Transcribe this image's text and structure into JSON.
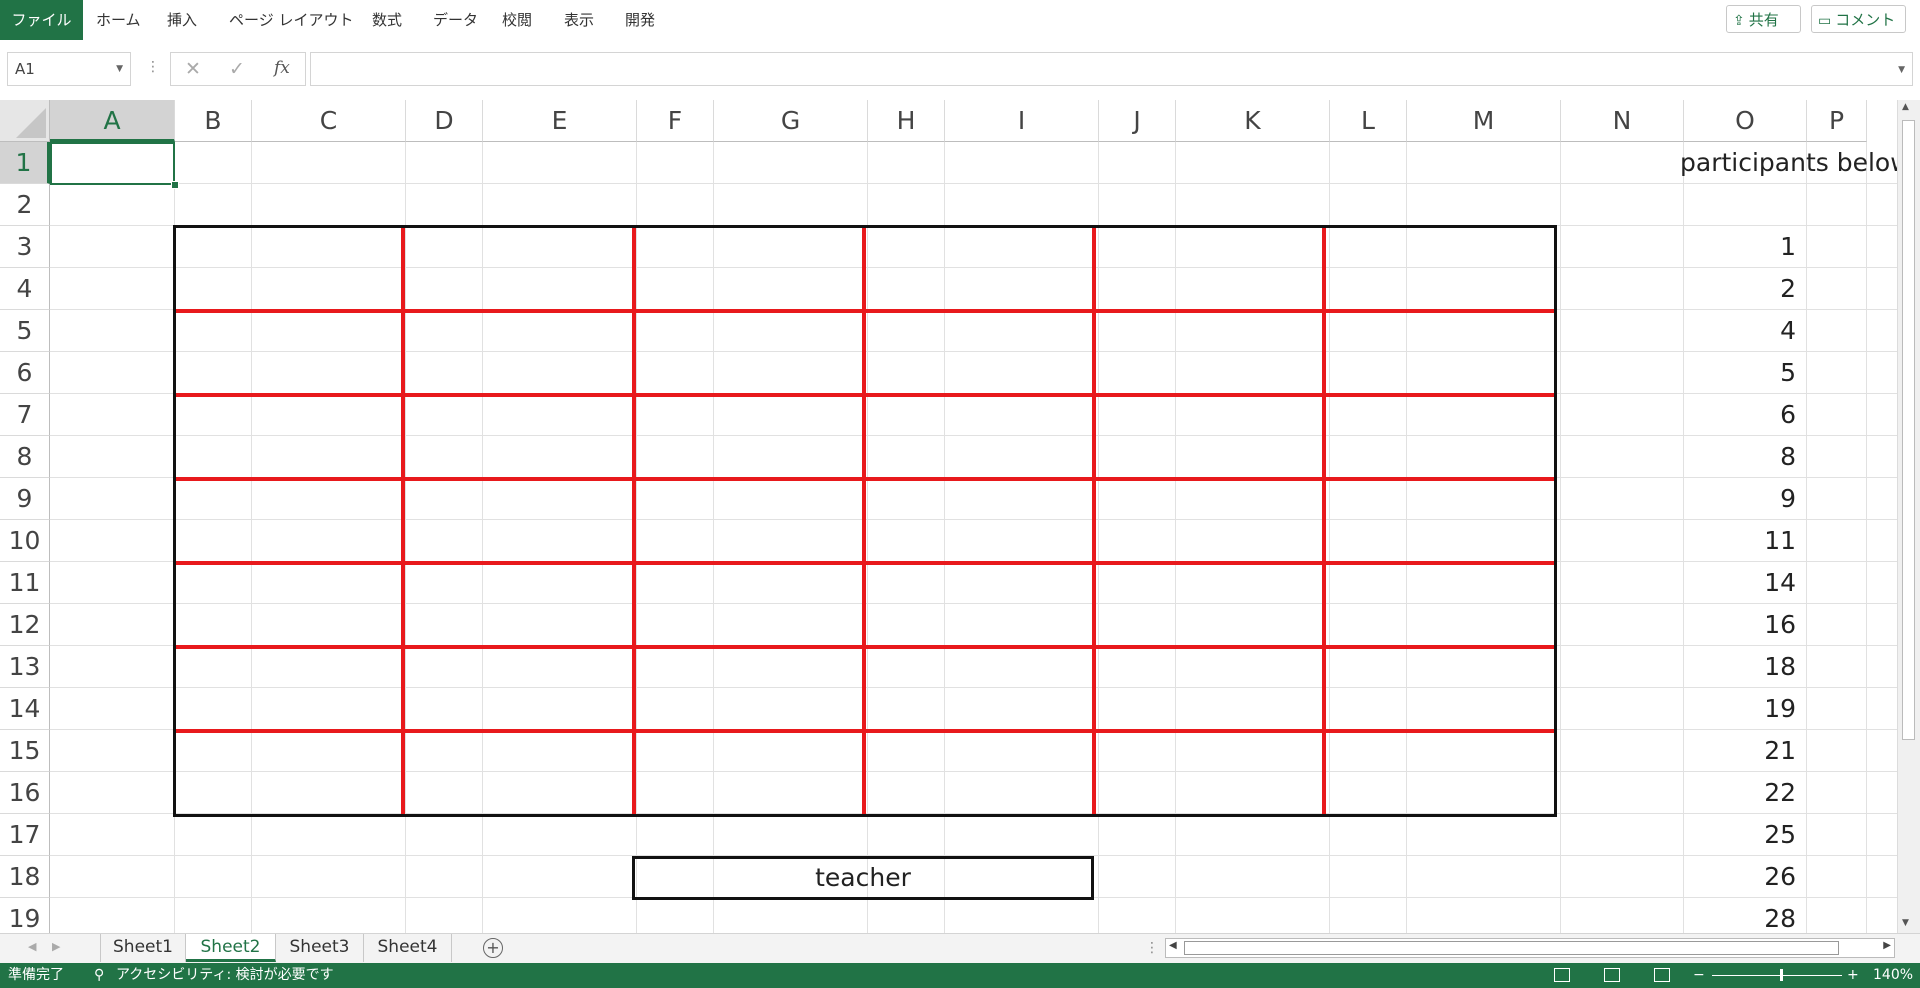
{
  "ribbon": {
    "file_tab": "ファイル",
    "tabs": [
      "ホーム",
      "挿入",
      "ページ レイアウト",
      "数式",
      "データ",
      "校閲",
      "表示",
      "開発"
    ],
    "share_label": "共有",
    "comment_label": "コメント"
  },
  "formula_bar": {
    "name_box": "A1",
    "formula": "",
    "fx_label": "fx"
  },
  "grid": {
    "columns": [
      "A",
      "B",
      "C",
      "D",
      "E",
      "F",
      "G",
      "H",
      "I",
      "J",
      "K",
      "L",
      "M",
      "N",
      "O",
      "P"
    ],
    "rows": [
      "1",
      "2",
      "3",
      "4",
      "5",
      "6",
      "7",
      "8",
      "9",
      "10",
      "11",
      "12",
      "13",
      "14",
      "15",
      "16",
      "17",
      "18",
      "19"
    ],
    "selected_cell": "A1",
    "o1_text": "participants below",
    "o_values": [
      "1",
      "2",
      "4",
      "5",
      "6",
      "8",
      "9",
      "11",
      "14",
      "16",
      "18",
      "19",
      "21",
      "22",
      "25",
      "26",
      "28"
    ],
    "teacher_label": "teacher",
    "seating_grid_color": "#e8191c"
  },
  "sheets": {
    "tabs": [
      "Sheet1",
      "Sheet2",
      "Sheet3",
      "Sheet4"
    ],
    "active": "Sheet2"
  },
  "status": {
    "ready": "準備完了",
    "accessibility": "アクセシビリティ: 検討が必要です",
    "zoom": "140%"
  },
  "colors": {
    "accent": "#217346"
  }
}
